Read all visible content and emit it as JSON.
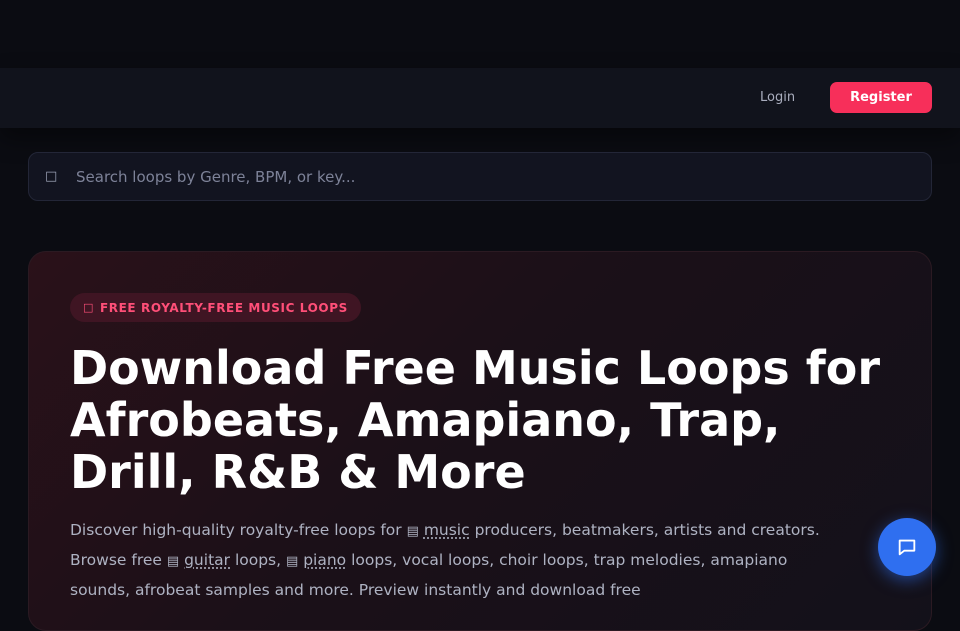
{
  "nav": {
    "login_label": "Login",
    "register_label": "Register"
  },
  "search": {
    "placeholder": "Search loops by Genre, BPM, or key...",
    "icon": "search-icon"
  },
  "hero": {
    "badge_text": "FREE ROYALTY-FREE MUSIC LOOPS",
    "title": "Download Free Music Loops for Afrobeats, Amapiano, Trap, Drill, R&B & More",
    "desc_1": "Discover high-quality royalty-free loops for ",
    "link_music": "music",
    "desc_2": " producers, beatmakers, artists and creators. Browse free ",
    "link_guitar": "guitar",
    "desc_3": " loops, ",
    "link_piano": "piano",
    "desc_4": " loops, vocal loops, choir loops, trap melodies, amapiano sounds, afrobeat samples and more. Preview instantly and download free"
  },
  "colors": {
    "accent": "#f72f5a",
    "chat": "#2f6ff0",
    "background": "#0b0c12"
  }
}
